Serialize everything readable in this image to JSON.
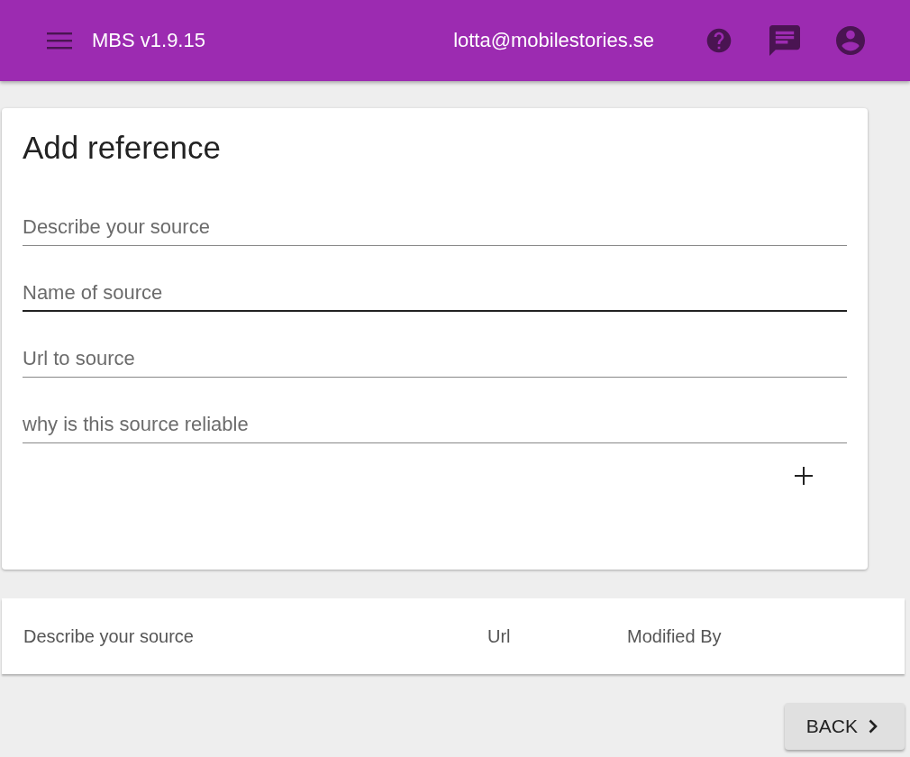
{
  "app_bar": {
    "title": "MBS v1.9.15",
    "user": "lotta@mobilestories.se"
  },
  "card": {
    "title": "Add reference",
    "fields": [
      {
        "placeholder": "Describe your source",
        "focused": false
      },
      {
        "placeholder": "Name of source",
        "focused": true
      },
      {
        "placeholder": "Url to source",
        "focused": false
      },
      {
        "placeholder": "why is this source reliable",
        "focused": false
      }
    ]
  },
  "table": {
    "columns": [
      "Describe your source",
      "Url",
      "Modified By"
    ]
  },
  "buttons": [
    "BACK"
  ]
}
